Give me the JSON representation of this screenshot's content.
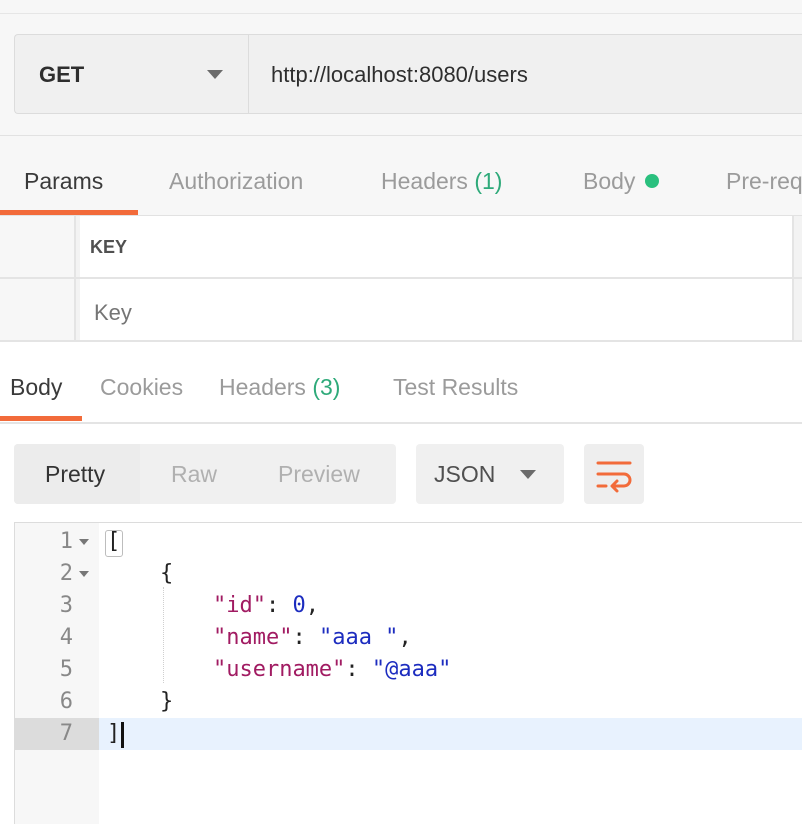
{
  "request": {
    "method": "GET",
    "url": "http://localhost:8080/users"
  },
  "request_tabs": {
    "params": "Params",
    "authorization": "Authorization",
    "headers": "Headers",
    "headers_count": "(1)",
    "body": "Body",
    "prerequest": "Pre-req"
  },
  "params_table": {
    "key_header": "KEY",
    "key_placeholder": "Key"
  },
  "response_tabs": {
    "body": "Body",
    "cookies": "Cookies",
    "headers": "Headers",
    "headers_count": "(3)",
    "test_results": "Test Results"
  },
  "format_toolbar": {
    "pretty": "Pretty",
    "raw": "Raw",
    "preview": "Preview",
    "language": "JSON",
    "wrap_icon": "wrap-lines-icon"
  },
  "response_body": {
    "line_numbers": [
      "1",
      "2",
      "3",
      "4",
      "5",
      "6",
      "7"
    ],
    "open_bracket": "[",
    "open_brace": "{",
    "id_key": "\"id\"",
    "id_value": "0",
    "name_key": "\"name\"",
    "name_value": "\"aaa \"",
    "username_key": "\"username\"",
    "username_value": "\"@aaa\"",
    "close_brace": "}",
    "close_bracket": "]"
  },
  "colors": {
    "accent": "#f26b3a",
    "count_green": "#2faa7a",
    "key_color": "#a11b62",
    "value_color": "#1c2cbf"
  }
}
